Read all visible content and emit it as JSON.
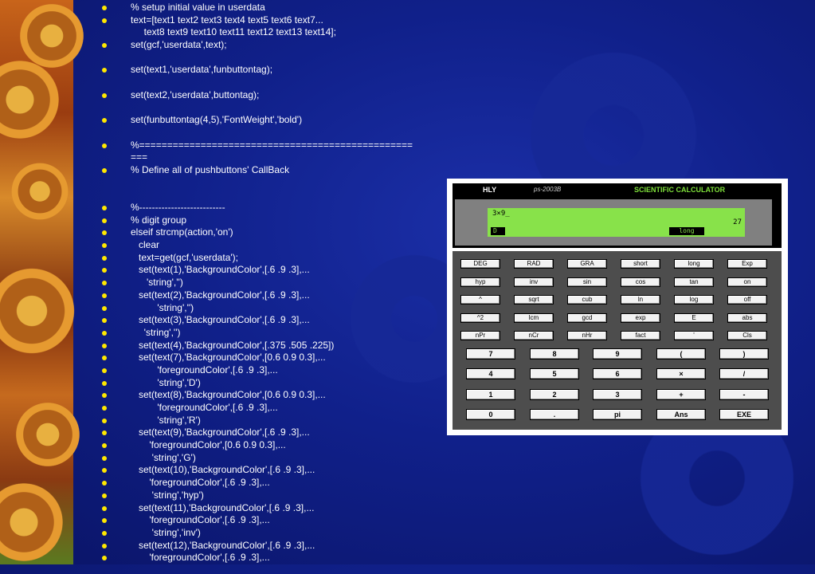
{
  "code_lines": [
    "% setup initial value in userdata",
    "text=[text1 text2 text3 text4 text5 text6 text7...",
    "     text8 text9 text10 text11 text12 text13 text14];",
    "set(gcf,'userdata',text);",
    "",
    "set(text1,'userdata',funbuttontag);",
    "",
    "set(text2,'userdata',buttontag);",
    "",
    "set(funbuttontag(4,5),'FontWeight','bold')",
    "",
    "%=================================================",
    "===",
    "% Define all of pushbuttons' CallBack",
    "",
    "",
    "%---------------------------",
    "% digit group",
    "elseif strcmp(action,'on')",
    "   clear",
    "   text=get(gcf,'userdata');",
    "   set(text(1),'BackgroundColor',[.6 .9 .3],...",
    "      'string','')",
    "   set(text(2),'BackgroundColor',[.6 .9 .3],...",
    "          'string','')",
    "   set(text(3),'BackgroundColor',[.6 .9 .3],...",
    "     'string','')",
    "   set(text(4),'BackgroundColor',[.375 .505 .225])",
    "   set(text(7),'BackgroundColor',[0.6 0.9 0.3],...",
    "          'foregroundColor',[.6 .9 .3],...",
    "          'string','D')",
    "   set(text(8),'BackgroundColor',[0.6 0.9 0.3],...",
    "          'foregroundColor',[.6 .9 .3],...",
    "          'string','R')",
    "   set(text(9),'BackgroundColor',[.6 .9 .3],...",
    "       'foregroundColor',[0.6 0.9 0.3],...",
    "        'string','G')",
    "   set(text(10),'BackgroundColor',[.6 .9 .3],...",
    "       'foregroundColor',[.6 .9 .3],...",
    "        'string','hyp')",
    "   set(text(11),'BackgroundColor',[.6 .9 .3],...",
    "       'foregroundColor',[.6 .9 .3],...",
    "        'string','inv')",
    "   set(text(12),'BackgroundColor',[.6 .9 .3],...",
    "       'foregroundColor',[.6 .9 .3],..."
  ],
  "bulleted": [
    true,
    true,
    false,
    true,
    false,
    true,
    false,
    true,
    false,
    true,
    false,
    true,
    false,
    true,
    false,
    false,
    true,
    true,
    true,
    true,
    true,
    true,
    true,
    true,
    true,
    true,
    true,
    true,
    true,
    true,
    true,
    true,
    true,
    true,
    true,
    true,
    true,
    true,
    true,
    true,
    true,
    true,
    true,
    true,
    true
  ],
  "calculator": {
    "brand": "HLY",
    "model": "ps-2003B",
    "name": "SCIENTIFIC CALCULATOR",
    "input": "3×9_",
    "result": "27",
    "angle_mode": "D",
    "length_mode": "long",
    "function_rows": [
      [
        "DEG",
        "RAD",
        "GRA",
        "short",
        "long",
        "Exp"
      ],
      [
        "hyp",
        "inv",
        "sin",
        "cos",
        "tan",
        "on"
      ],
      [
        "^",
        "sqrt",
        "cub",
        "ln",
        "log",
        "off"
      ],
      [
        "^2",
        "lcm",
        "gcd",
        "exp",
        "E",
        "abs"
      ],
      [
        "nPr",
        "nCr",
        "nHr",
        "fact",
        "'",
        "Cls"
      ]
    ],
    "digit_rows": [
      [
        "7",
        "8",
        "9",
        "(",
        ")"
      ],
      [
        "4",
        "5",
        "6",
        "×",
        "/"
      ],
      [
        "1",
        "2",
        "3",
        "+",
        "-"
      ],
      [
        "0",
        ".",
        "pi",
        "Ans",
        "EXE"
      ]
    ]
  },
  "colors": {
    "bullet": "#ffe800",
    "lcd": "#88e24a",
    "background": "#10208a"
  }
}
